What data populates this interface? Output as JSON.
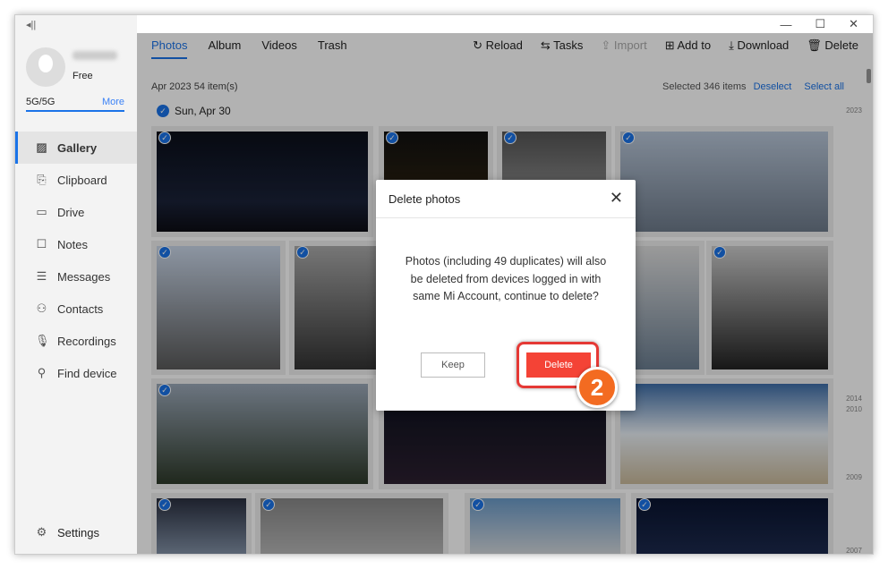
{
  "sidebar": {
    "plan": "Free",
    "storage": "5G/5G",
    "storage_used_fraction": 1.0,
    "more": "More",
    "items": [
      {
        "label": "Gallery",
        "icon": "image-icon"
      },
      {
        "label": "Clipboard",
        "icon": "clipboard-icon"
      },
      {
        "label": "Drive",
        "icon": "folder-icon"
      },
      {
        "label": "Notes",
        "icon": "note-icon"
      },
      {
        "label": "Messages",
        "icon": "message-icon"
      },
      {
        "label": "Contacts",
        "icon": "person-icon"
      },
      {
        "label": "Recordings",
        "icon": "mic-icon"
      },
      {
        "label": "Find device",
        "icon": "location-icon"
      }
    ],
    "settings": "Settings"
  },
  "window": {
    "minimize": "—",
    "maximize": "☐",
    "close": "✕"
  },
  "tabs": [
    "Photos",
    "Album",
    "Videos",
    "Trash"
  ],
  "toolbar": {
    "reload": "Reload",
    "tasks": "Tasks",
    "import": "Import",
    "add_to": "Add to",
    "download": "Download",
    "delete": "Delete"
  },
  "info": "Apr 2023 54 item(s)",
  "selection": {
    "text": "Selected 346 items",
    "deselect": "Deselect",
    "select_all": "Select all"
  },
  "date_group": "Sun, Apr 30",
  "timeline": [
    "2023",
    "2014",
    "2010",
    "2009",
    "2007"
  ],
  "dialog": {
    "title": "Delete photos",
    "message": "Photos (including 49 duplicates) will also be deleted from devices logged in with same Mi Account, continue to delete?",
    "keep": "Keep",
    "delete": "Delete"
  },
  "step_badge": "2",
  "colors": {
    "accent": "#1a73e8",
    "danger": "#f44336",
    "step": "#f36b21"
  }
}
